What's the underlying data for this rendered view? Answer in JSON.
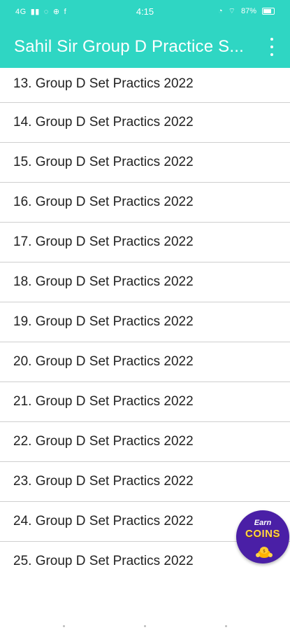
{
  "status_bar": {
    "network_left": "4G",
    "time": "4:15",
    "battery_text": "87%"
  },
  "app_bar": {
    "title": "Sahil Sir Group D Practice S...",
    "menu_icon": "more-vert-icon"
  },
  "list": {
    "items": [
      "13. Group D Set Practics 2022",
      "14. Group D Set Practics 2022",
      "15. Group D Set Practics 2022",
      "16. Group D Set Practics 2022",
      "17. Group D Set Practics 2022",
      "18. Group D Set Practics 2022",
      "19. Group D Set Practics 2022",
      "20. Group D Set Practics 2022",
      "21. Group D Set Practics 2022",
      "22. Group D Set Practics 2022",
      "23. Group D Set Practics 2022",
      "24. Group D Set Practics 2022",
      "25. Group D Set Practics 2022"
    ]
  },
  "earn_coins": {
    "line1": "Earn",
    "line2": "COINS"
  },
  "colors": {
    "accent": "#2fd6c3",
    "badge_bg": "#4a1fa6",
    "coin_gold": "#ffd54a"
  }
}
